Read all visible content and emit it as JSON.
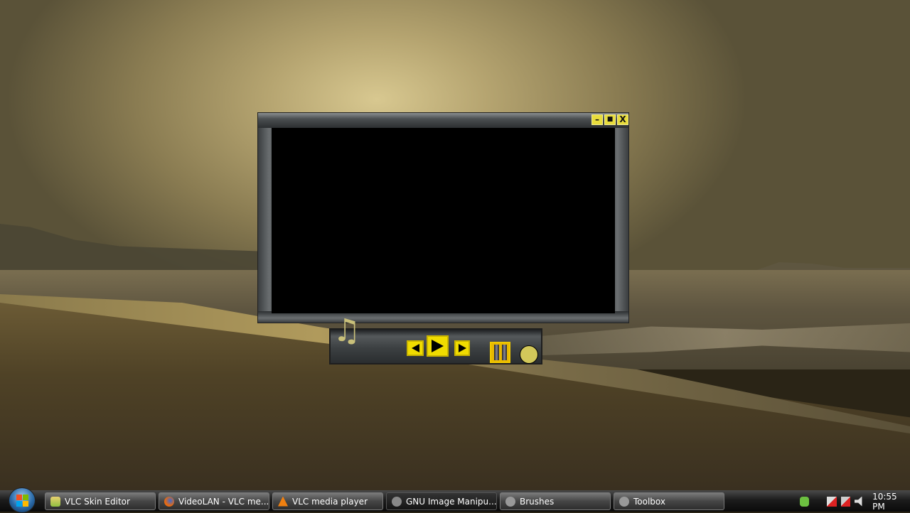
{
  "vlc_window": {
    "minimize_label": "–",
    "maximize_label": "■",
    "close_label": "X",
    "accent_color": "#f0dc00"
  },
  "controls": {
    "music_icon": "♫",
    "previous": "previous-icon",
    "play": "play-icon",
    "next": "next-icon",
    "pause": "pause-icon",
    "stop": "stop-icon"
  },
  "taskbar": {
    "items": [
      {
        "label": "VLC Skin Editor",
        "icon": "skin-editor-icon"
      },
      {
        "label": "VideoLAN - VLC me...",
        "icon": "firefox-icon"
      },
      {
        "label": "VLC media player",
        "icon": "vlc-cone-icon"
      },
      {
        "label": "GNU Image Manipu...",
        "icon": "gimp-icon",
        "active": true
      },
      {
        "label": "Brushes",
        "icon": "gimp-icon"
      },
      {
        "label": "Toolbox",
        "icon": "gimp-icon"
      }
    ],
    "clock": "10:55 PM"
  }
}
